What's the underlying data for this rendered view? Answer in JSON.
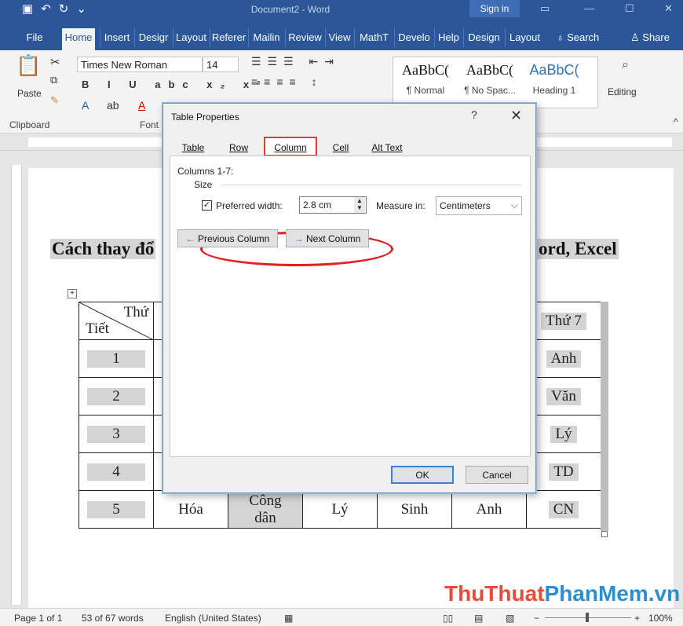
{
  "titlebar": {
    "title": "Document2 - Word",
    "sign_in": "Sign in"
  },
  "ribbon_tabs": [
    "File",
    "Home",
    "Insert",
    "Desigr",
    "Layout",
    "Referer",
    "Mailin",
    "Review",
    "View",
    "MathT",
    "Develo",
    "Help",
    "Design",
    "Layout"
  ],
  "search": {
    "label": "Search",
    "share": "Share"
  },
  "ribbon": {
    "paste": "Paste",
    "font_name": "Times New Roman",
    "font_size": "14",
    "styles": [
      {
        "sample": "AaBbC(",
        "name": "¶ Normal"
      },
      {
        "sample": "AaBbC(",
        "name": "¶ No Spac..."
      },
      {
        "sample": "AaBbC(",
        "name": "Heading 1"
      }
    ],
    "editing": "Editing",
    "group_clipboard": "Clipboard",
    "group_font": "Font"
  },
  "document": {
    "heading_left": "Cách thay đổ",
    "heading_right": "ord, Excel",
    "table": {
      "header": {
        "diag_top": "Thứ",
        "diag_bottom": "Tiết",
        "last": "Thứ 7"
      },
      "rows": [
        {
          "num": "1",
          "last": "Anh"
        },
        {
          "num": "2",
          "last": "Văn"
        },
        {
          "num": "3",
          "last": "Lý"
        },
        {
          "num": "4",
          "last": "TD"
        },
        {
          "num": "5",
          "c2": "Hóa",
          "c3a": "Công",
          "c3b": "dân",
          "c4": "Lý",
          "c5": "Sinh",
          "c6": "Anh",
          "last": "CN"
        }
      ]
    }
  },
  "dialog": {
    "title": "Table Properties",
    "help": "?",
    "close": "✕",
    "tabs": [
      "Table",
      "Row",
      "Column",
      "Cell",
      "Alt Text"
    ],
    "columns_label": "Columns 1-7:",
    "size_label": "Size",
    "preferred_width_label": "Preferred width:",
    "preferred_width_checked": true,
    "preferred_width_value": "2.8 cm",
    "measure_in_label": "Measure in:",
    "measure_in_value": "Centimeters",
    "prev_column": "Previous Column",
    "next_column": "Next Column",
    "ok": "OK",
    "cancel": "Cancel"
  },
  "statusbar": {
    "page": "Page 1 of 1",
    "words": "53 of 67 words",
    "language": "English (United States)",
    "zoom": "100%"
  },
  "watermark": {
    "part1": "ThuThuat",
    "part2": "PhanMem.vn"
  },
  "colors": {
    "accent": "#2b579a",
    "highlight_red": "#e32020",
    "arrow_red": "#e84b3a"
  }
}
